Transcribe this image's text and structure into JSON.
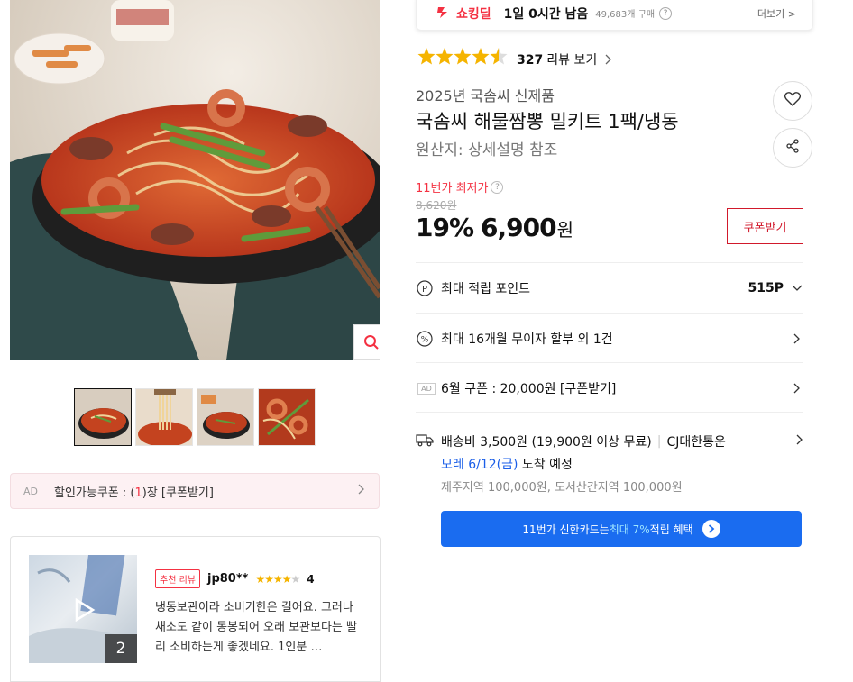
{
  "deal_bar": {
    "label": "쇼킹딜",
    "remaining": "1일 0시간 남음",
    "sold": "49,683개 구매",
    "help": "?",
    "more": "더보기 >"
  },
  "rating": {
    "stars": 4.5,
    "count": "327",
    "link_label": "리뷰 보기"
  },
  "product": {
    "subtitle": "2025년 국솜씨 신제품",
    "title": "국솜씨 해물짬뽕 밀키트 1팩/냉동",
    "origin": "원산지:  상세설명 참조"
  },
  "price": {
    "lowest_label": "11번가 최저가",
    "original": "8,620원",
    "discount": "19%",
    "sale": "6,900",
    "currency": "원",
    "coupon_button": "쿠폰받기"
  },
  "benefits": {
    "points_label": "최대 적립 포인트",
    "points_value": "515P",
    "installment_label": "최대 16개월 무이자 할부 외 1건",
    "ad_tag": "AD",
    "coupon_label": "6월 쿠폰 : 20,000원 [쿠폰받기]"
  },
  "shipping": {
    "fee": "배송비 3,500원 (19,900원 이상 무료)",
    "separator": "|",
    "carrier": "CJ대한통운",
    "arrival_date": "모레 6/12(금)",
    "arrival_suffix": " 도착 예정",
    "extra": "제주지역 100,000원, 도서산간지역 100,000원"
  },
  "card_banner": {
    "prefix": "11번가 신한카드는 ",
    "highlight": "최대 7%",
    "suffix": " 적립 혜택"
  },
  "ad_coupon": {
    "ad_tag": "AD",
    "text_prefix": "할인가능쿠폰 : (",
    "count": "1",
    "text_suffix": ")장 [쿠폰받기]"
  },
  "review": {
    "badge": "추천 리뷰",
    "reviewer": "jp80**",
    "score": "4",
    "stars": 4,
    "image_count": "2",
    "text": "냉동보관이라 소비기한은 길어요. 그러나 채소도 같이 동봉되어 오래 보관보다는 빨리 소비하는게 좋겠네요. 1인분 …"
  },
  "icons": {
    "zoom": "search-icon",
    "heart": "heart-icon",
    "share": "share-icon",
    "points": "point-icon",
    "installment": "percent-icon",
    "shipping": "truck-icon",
    "deal": "shocking-deal-icon",
    "play": "play-icon"
  },
  "colors": {
    "accent_red": "#f43142",
    "star": "#f5b400",
    "banner_blue": "#1a6cf0",
    "link_blue": "#1a5ee8"
  }
}
